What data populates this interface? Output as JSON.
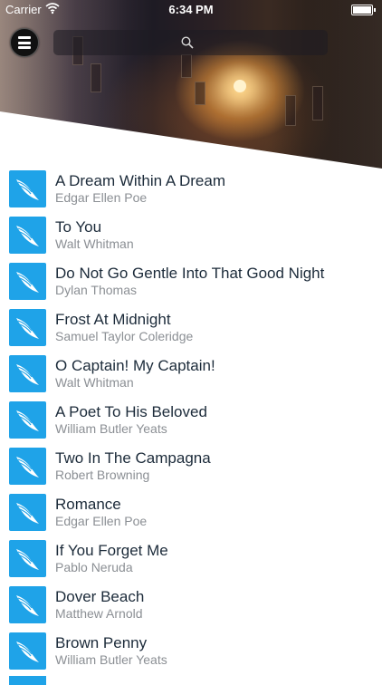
{
  "status_bar": {
    "carrier": "Carrier",
    "time": "6:34 PM"
  },
  "search": {
    "placeholder": ""
  },
  "poems": [
    {
      "title": "A Dream Within A Dream",
      "author": "Edgar Ellen Poe"
    },
    {
      "title": "To You",
      "author": "Walt Whitman"
    },
    {
      "title": "Do Not Go Gentle Into That Good Night",
      "author": "Dylan Thomas"
    },
    {
      "title": "Frost At Midnight",
      "author": "Samuel Taylor Coleridge"
    },
    {
      "title": "O Captain! My Captain!",
      "author": "Walt Whitman"
    },
    {
      "title": "A Poet To His Beloved",
      "author": "William Butler Yeats"
    },
    {
      "title": "Two In The Campagna",
      "author": "Robert Browning"
    },
    {
      "title": "Romance",
      "author": "Edgar Ellen Poe"
    },
    {
      "title": "If You Forget Me",
      "author": "Pablo Neruda"
    },
    {
      "title": "Dover Beach",
      "author": "Matthew Arnold"
    },
    {
      "title": "Brown Penny",
      "author": "William Butler Yeats"
    }
  ],
  "colors": {
    "tile": "#1fa3e8",
    "title": "#1c2b3a",
    "author": "#8b8f94"
  }
}
